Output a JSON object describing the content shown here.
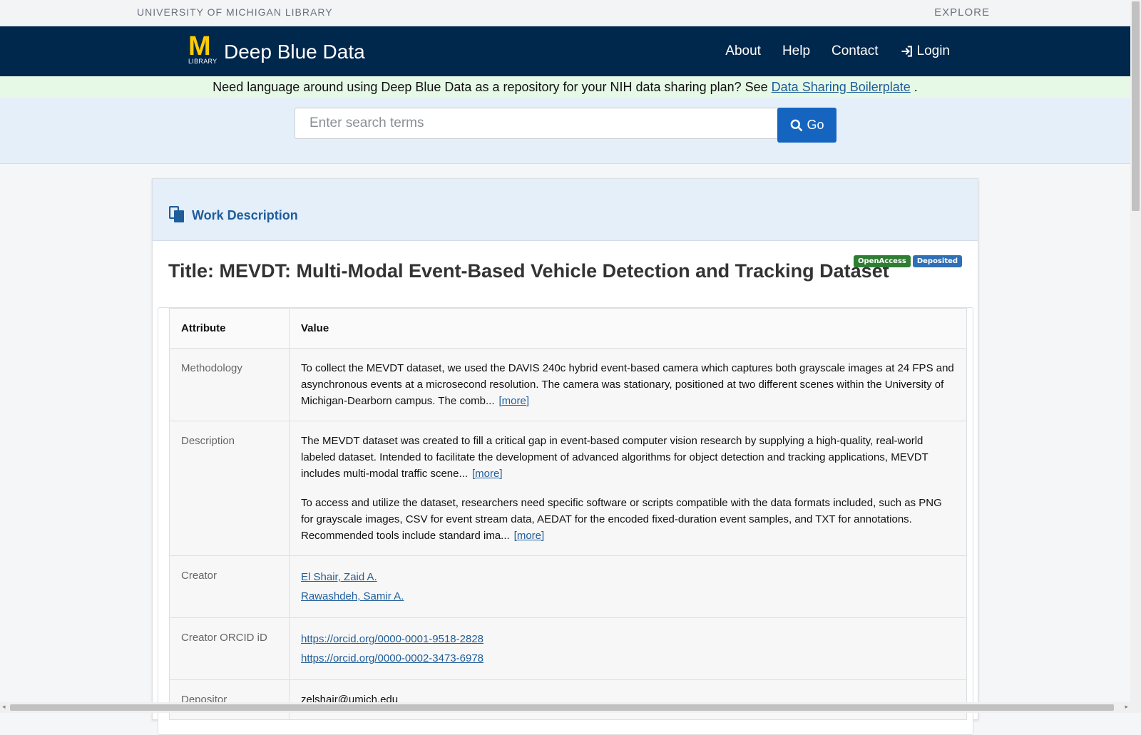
{
  "utility": {
    "university": "UNIVERSITY OF MICHIGAN LIBRARY",
    "explore": "EXPLORE"
  },
  "navbar": {
    "logo_letter": "M",
    "logo_sub": "LIBRARY",
    "title": "Deep Blue Data",
    "links": [
      "About",
      "Help",
      "Contact"
    ],
    "login": "Login"
  },
  "announcement": {
    "text": "Need language around using Deep Blue Data as a repository for your NIH data sharing plan? See ",
    "link": "Data Sharing Boilerplate",
    "suffix": " ."
  },
  "search": {
    "placeholder": "Enter search terms",
    "button": "Go"
  },
  "panel": {
    "heading": "Work Description",
    "title": "Title: MEVDT: Multi-Modal Event-Based Vehicle Detection and Tracking Dataset",
    "badges": [
      "OpenAccess",
      "Deposited"
    ]
  },
  "table": {
    "headers": [
      "Attribute",
      "Value"
    ],
    "rows": {
      "methodology": {
        "label": "Methodology",
        "text": "To collect the MEVDT dataset, we used the DAVIS 240c hybrid event-based camera which captures both grayscale images at 24 FPS and asynchronous events at a microsecond resolution. The camera was stationary, positioned at two different scenes within the University of Michigan-Dearborn campus. The comb...",
        "more": "[more]"
      },
      "description": {
        "label": "Description",
        "text1": "The MEVDT dataset was created to fill a critical gap in event-based computer vision research by supplying a high-quality, real-world labeled dataset. Intended to facilitate the development of advanced algorithms for object detection and tracking applications, MEVDT includes multi-modal traffic scene...",
        "more1": "[more]",
        "text2": "To access and utilize the dataset, researchers need specific software or scripts compatible with the data formats included, such as PNG for grayscale images, CSV for event stream data, AEDAT for the encoded fixed-duration event samples, and TXT for annotations. Recommended tools include standard ima...",
        "more2": "[more]"
      },
      "creator": {
        "label": "Creator",
        "names": [
          "El Shair, Zaid A.",
          "Rawashdeh, Samir A."
        ]
      },
      "orcid": {
        "label": "Creator ORCID iD",
        "links": [
          "https://orcid.org/0000-0001-9518-2828",
          "https://orcid.org/0000-0002-3473-6978"
        ]
      },
      "depositor": {
        "label": "Depositor",
        "value": "zelshair@umich.edu"
      }
    }
  },
  "colors": {
    "navy": "#00274c",
    "maize": "#ffcb05",
    "link": "#1f5d9a",
    "go_button": "#1565c0"
  },
  "icons": [
    "document-icon",
    "search-icon",
    "login-icon"
  ]
}
